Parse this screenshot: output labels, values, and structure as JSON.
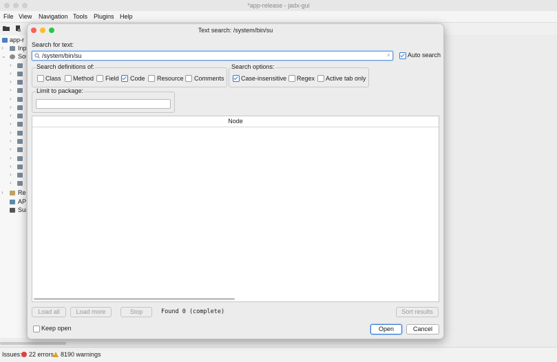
{
  "window": {
    "title": "*app-release - jadx-gui",
    "menu": [
      "File",
      "View",
      "Navigation",
      "Tools",
      "Plugins",
      "Help"
    ]
  },
  "tree": {
    "root_label": "app-r",
    "rows": [
      {
        "label": "Inp"
      },
      {
        "label": "Sou"
      },
      {
        "label": "Res"
      },
      {
        "label": "APK"
      },
      {
        "label": "Sun"
      }
    ]
  },
  "status": {
    "issues_label": "Issues:",
    "errors": "22 errors",
    "warnings": "8190 warnings"
  },
  "dialog": {
    "title": "Text search: /system/bin/su",
    "search_label": "Search for text:",
    "search_value": "/system/bin/su",
    "clear_glyph": "×",
    "auto_search_label": "Auto search",
    "auto_search_checked": true,
    "definitions_label": "Search definitions of:",
    "definitions": [
      {
        "label": "Class",
        "checked": false
      },
      {
        "label": "Method",
        "checked": false
      },
      {
        "label": "Field",
        "checked": false
      },
      {
        "label": "Code",
        "checked": true
      },
      {
        "label": "Resource",
        "checked": false
      },
      {
        "label": "Comments",
        "checked": false
      }
    ],
    "options_label": "Search options:",
    "options": [
      {
        "label": "Case-insensitive",
        "checked": true
      },
      {
        "label": "Regex",
        "checked": false
      },
      {
        "label": "Active tab only",
        "checked": false
      }
    ],
    "package_label": "Limit to package:",
    "package_value": "",
    "results_column": "Node",
    "load_all": "Load all",
    "load_more": "Load more",
    "stop": "Stop",
    "found_text": "Found 0 (complete)",
    "sort_results": "Sort results",
    "keep_open_label": "Keep open",
    "keep_open_checked": false,
    "open": "Open",
    "cancel": "Cancel"
  },
  "colors": {
    "accent": "#3478d0",
    "close": "#fe5f57",
    "minimize": "#febc2e",
    "maximize": "#28c840",
    "error": "#e04040",
    "warning": "#e0a020"
  }
}
